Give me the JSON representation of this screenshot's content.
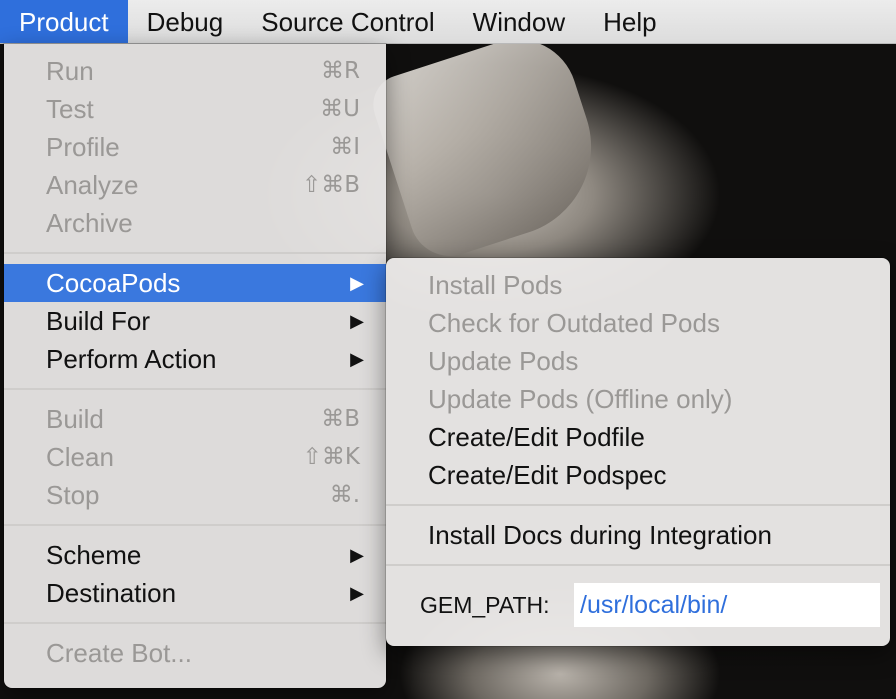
{
  "menubar": {
    "items": [
      "Product",
      "Debug",
      "Source Control",
      "Window",
      "Help"
    ],
    "active": "Product"
  },
  "product_menu": {
    "group1": [
      {
        "label": "Run",
        "shortcut": "⌘R"
      },
      {
        "label": "Test",
        "shortcut": "⌘U"
      },
      {
        "label": "Profile",
        "shortcut": "⌘I"
      },
      {
        "label": "Analyze",
        "shortcut": "⇧⌘B"
      },
      {
        "label": "Archive",
        "shortcut": ""
      }
    ],
    "group2": [
      {
        "label": "CocoaPods",
        "arrow": "▶"
      },
      {
        "label": "Build For",
        "arrow": "▶"
      },
      {
        "label": "Perform Action",
        "arrow": "▶"
      }
    ],
    "group3": [
      {
        "label": "Build",
        "shortcut": "⌘B"
      },
      {
        "label": "Clean",
        "shortcut": "⇧⌘K"
      },
      {
        "label": "Stop",
        "shortcut": "⌘."
      }
    ],
    "group4": [
      {
        "label": "Scheme",
        "arrow": "▶"
      },
      {
        "label": "Destination",
        "arrow": "▶"
      }
    ],
    "group5": [
      {
        "label": "Create Bot..."
      }
    ]
  },
  "cocoapods_submenu": {
    "items": [
      "Install Pods",
      "Check for Outdated Pods",
      "Update Pods",
      "Update Pods (Offline only)",
      "Create/Edit Podfile",
      "Create/Edit Podspec"
    ],
    "install_docs": "Install Docs during Integration",
    "gem_path_label": "GEM_PATH:",
    "gem_path_value": "/usr/local/bin/"
  },
  "colors": {
    "selection": "#3a78de",
    "menubar_active": "#2f6fdc",
    "disabled_text": "#9a9896",
    "input_text": "#2f6fdc"
  }
}
